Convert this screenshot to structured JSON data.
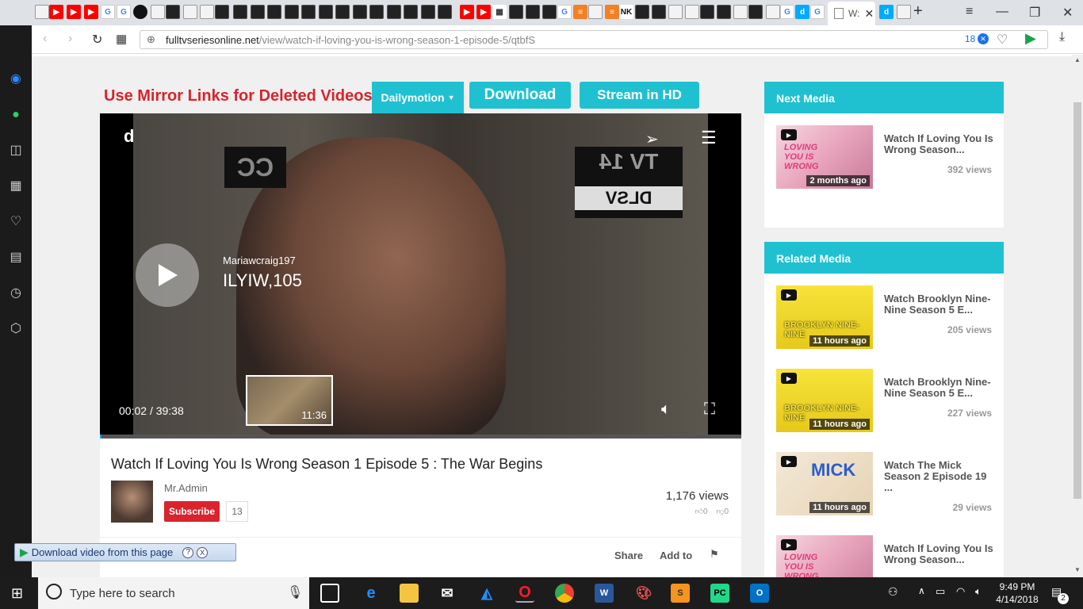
{
  "browser": {
    "active_tab_title": "W:",
    "url_domain": "fulltvseriesonline.net",
    "url_path": "/view/watch-if-loving-you-is-wrong-season-1-episode-5/qtbfS",
    "ad_block_count": "18"
  },
  "page": {
    "mirror_text": "Use Mirror Links for Deleted Videos:",
    "dailymotion_label": "Dailymotion",
    "download_label": "Download",
    "stream_label": "Stream in HD"
  },
  "player": {
    "logo": "d",
    "cc_text": "CC",
    "tv_rating": "TV 14",
    "tv_sub": "DLSV",
    "channel": "Mariawcraig197",
    "title": "ILYIW,105",
    "current_time": "00:02",
    "duration": "39:38",
    "time_separator": "/",
    "preview_time": "11:36",
    "progress_fraction": 0.001
  },
  "video": {
    "title": "Watch If Loving You Is Wrong Season 1 Episode 5 : The War Begins",
    "author": "Mr.Admin",
    "subscribe_label": "Subscribe",
    "subscriber_count": "13",
    "views": "1,176 views",
    "likes": "0",
    "dislikes": "0",
    "share_label": "Share",
    "add_to_label": "Add to"
  },
  "sidebar": {
    "next_header": "Next Media",
    "related_header": "Related Media",
    "next": [
      {
        "title": "Watch If Loving You Is Wrong Season...",
        "views": "392 views",
        "ago": "2 months ago",
        "thumb_label": "LOVING YOU IS WRONG"
      }
    ],
    "related": [
      {
        "title": "Watch Brooklyn Nine-Nine Season 5 E...",
        "views": "205 views",
        "ago": "11 hours ago",
        "thumb_label": "BROOKLYN NINE-NINE"
      },
      {
        "title": "Watch Brooklyn Nine-Nine Season 5 E...",
        "views": "227 views",
        "ago": "11 hours ago",
        "thumb_label": "BROOKLYN NINE-NINE"
      },
      {
        "title": "Watch The Mick Season 2 Episode 19 ...",
        "views": "29 views",
        "ago": "11 hours ago",
        "thumb_label": "MICK"
      },
      {
        "title": "Watch If Loving You Is Wrong Season...",
        "views": "",
        "ago": "",
        "thumb_label": "LOVING YOU IS WRONG"
      }
    ]
  },
  "download_helper": {
    "label": "Download video from this page",
    "help": "?",
    "close": "X"
  },
  "taskbar": {
    "search_placeholder": "Type here to search",
    "time": "9:49 PM",
    "date": "4/14/2018",
    "notifications": "2"
  }
}
